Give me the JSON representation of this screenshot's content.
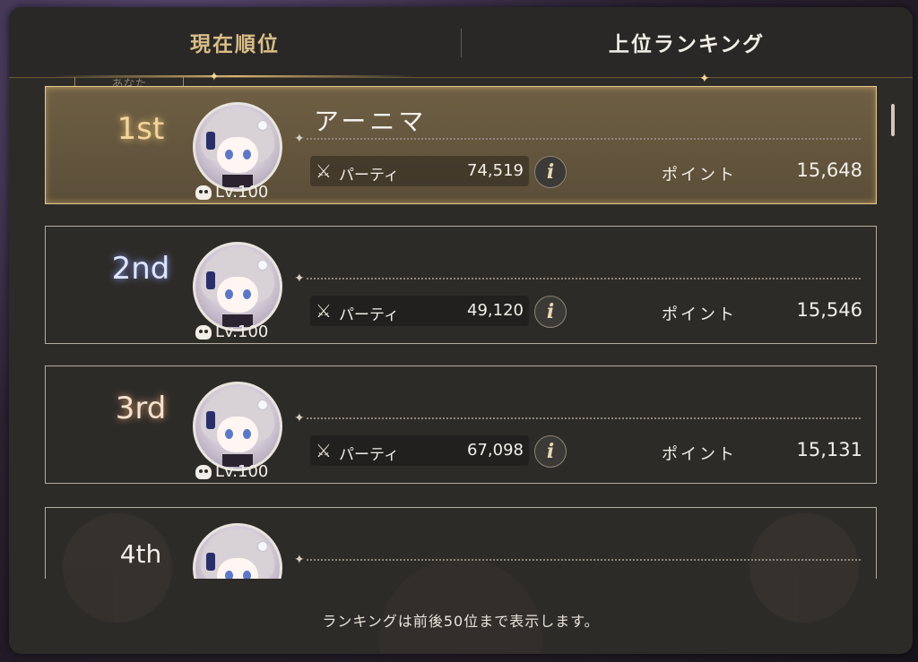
{
  "tabs": {
    "current": "現在順位",
    "upper": "上位ランキング"
  },
  "tab_tag": "あなた",
  "rankings": [
    {
      "rank": "1st",
      "name": "アーニマ",
      "level": "Lv.100",
      "party_label": "パーティ",
      "party_power": "74,519",
      "points_label": "ポイント",
      "points": "15,648"
    },
    {
      "rank": "2nd",
      "name": "",
      "level": "Lv.100",
      "party_label": "パーティ",
      "party_power": "49,120",
      "points_label": "ポイント",
      "points": "15,546"
    },
    {
      "rank": "3rd",
      "name": "",
      "level": "Lv.100",
      "party_label": "パーティ",
      "party_power": "67,098",
      "points_label": "ポイント",
      "points": "15,131"
    },
    {
      "rank": "4th",
      "name": "",
      "level": "",
      "party_label": "",
      "party_power": "",
      "points_label": "",
      "points": ""
    }
  ],
  "info_icon_glyph": "i",
  "footer_note": "ランキングは前後50位まで表示します。",
  "colors": {
    "panel_bg": "#2d2b28",
    "gold_accent": "#d9be88",
    "highlight_card": "#6e5f44"
  }
}
